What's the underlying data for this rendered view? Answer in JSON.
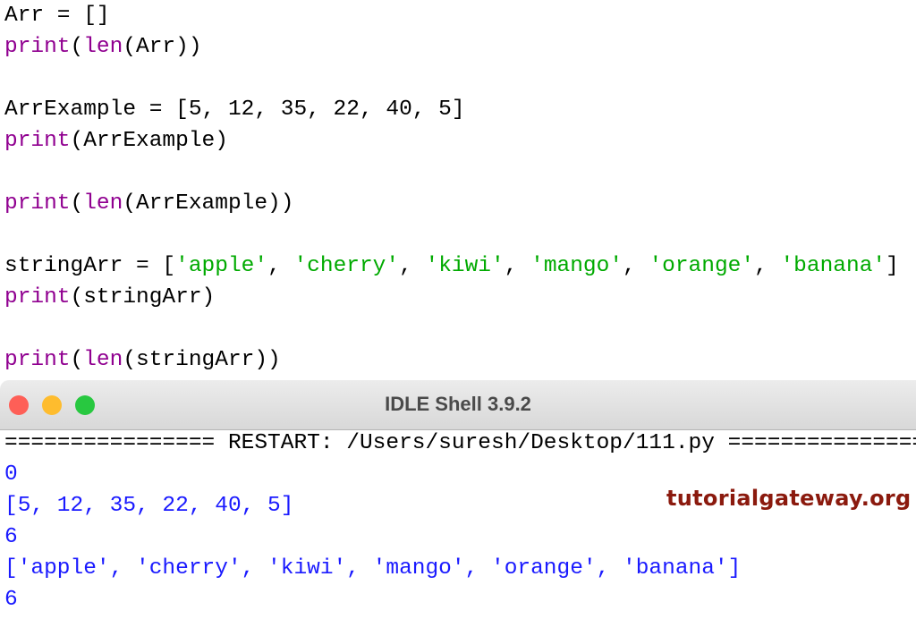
{
  "editor": {
    "lines": [
      {
        "plain": "Arr = []"
      },
      {
        "kw1": "print",
        "p1": "(",
        "kw2": "len",
        "p2": "(Arr))"
      },
      {
        "plain": "ArrExample = [5, 12, 35, 22, 40, 5]"
      },
      {
        "kw1": "print",
        "p1": "(ArrExample)"
      },
      {
        "kw1": "print",
        "p1": "(",
        "kw2": "len",
        "p2": "(ArrExample))"
      },
      {
        "prefix": "stringArr = [",
        "strings": [
          "'apple'",
          "'cherry'",
          "'kiwi'",
          "'mango'",
          "'orange'",
          "'banana'"
        ],
        "sep": ", ",
        "suffix": "]"
      },
      {
        "kw1": "print",
        "p1": "(stringArr)"
      },
      {
        "kw1": "print",
        "p1": "(",
        "kw2": "len",
        "p2": "(stringArr))"
      }
    ]
  },
  "window": {
    "title": "IDLE Shell 3.9.2",
    "buttons": {
      "close": "#fe5f57",
      "minimize": "#febc2e",
      "zoom": "#28c840"
    }
  },
  "shell": {
    "restart": "================ RESTART: /Users/suresh/Desktop/111.py ================",
    "output": [
      "0",
      "[5, 12, 35, 22, 40, 5]",
      "6",
      "['apple', 'cherry', 'kiwi', 'mango', 'orange', 'banana']",
      "6"
    ]
  },
  "watermark": "tutorialgateway.org",
  "colors": {
    "keyword": "#900090",
    "string": "#00aa00",
    "output": "#1a1aff",
    "watermark": "#8b1a0e"
  }
}
